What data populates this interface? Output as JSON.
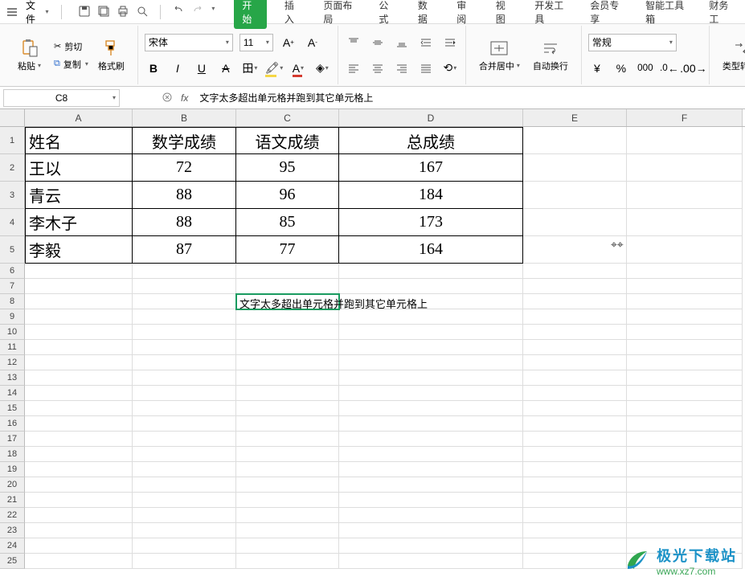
{
  "menubar": {
    "file_label": "文件",
    "tabs": [
      "开始",
      "插入",
      "页面布局",
      "公式",
      "数据",
      "审阅",
      "视图",
      "开发工具",
      "会员专享",
      "智能工具箱",
      "财务工"
    ],
    "active_tab_index": 0
  },
  "ribbon": {
    "clipboard": {
      "paste": "粘贴",
      "cut": "剪切",
      "copy": "复制",
      "format_painter": "格式刷"
    },
    "font": {
      "name": "宋体",
      "size": "11",
      "bold": "B",
      "italic": "I",
      "underline": "U",
      "strike": "S"
    },
    "alignment": {
      "merge": "合并居中",
      "wrap": "自动换行"
    },
    "number": {
      "format": "常规",
      "currency": "¥"
    },
    "type_conv": "类型转换"
  },
  "formula_bar": {
    "name_box": "C8",
    "formula": "文字太多超出单元格并跑到其它单元格上"
  },
  "columns": [
    "A",
    "B",
    "C",
    "D",
    "E",
    "F"
  ],
  "col_widths": [
    "colA",
    "colB",
    "colC",
    "colD",
    "colE",
    "colF"
  ],
  "data_rows": [
    {
      "r": 1,
      "h": "rh-data",
      "A": "姓名",
      "B": "数学成绩",
      "C": "语文成绩",
      "D": "总成绩",
      "header": true
    },
    {
      "r": 2,
      "h": "rh-data",
      "A": "王以",
      "B": "72",
      "C": "95",
      "D": "167"
    },
    {
      "r": 3,
      "h": "rh-data",
      "A": "青云",
      "B": "88",
      "C": "96",
      "D": "184"
    },
    {
      "r": 4,
      "h": "rh-data",
      "A": "李木子",
      "B": "88",
      "C": "85",
      "D": "173"
    },
    {
      "r": 5,
      "h": "rh-data",
      "A": "李毅",
      "B": "87",
      "C": "77",
      "D": "164"
    }
  ],
  "empty_rows": [
    6,
    7,
    8,
    9,
    10,
    11,
    12,
    13,
    14,
    15,
    16,
    17,
    18,
    19,
    20,
    21,
    22,
    23,
    24,
    25
  ],
  "selected_cell": {
    "row": 8,
    "col": "C",
    "text": "文字太多超出单元格并跑到其它单元格上"
  },
  "watermark": {
    "title": "极光下载站",
    "url": "www.xz7.com"
  }
}
